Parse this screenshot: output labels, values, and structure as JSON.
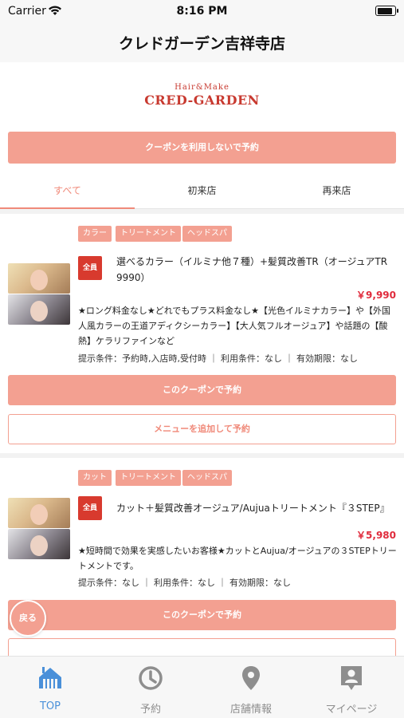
{
  "status_bar": {
    "carrier": "Carrier",
    "time": "8:16 PM"
  },
  "nav": {
    "title": "クレドガーデン吉祥寺店"
  },
  "logo": {
    "top": "Hair&Make",
    "main": "CRED-GARDEN"
  },
  "reserve_without_coupon": "クーポンを利用しないで予約",
  "tabs": [
    {
      "label": "すべて",
      "active": true
    },
    {
      "label": "初来店",
      "active": false
    },
    {
      "label": "再来店",
      "active": false
    }
  ],
  "coupons": [
    {
      "tags": [
        "カラー",
        "トリートメント",
        "ヘッドスパ"
      ],
      "badge": "全員",
      "name": "選べるカラー（イルミナ他７種）+髪質改善TR（オージュアTR 9990）",
      "price": "￥9,990",
      "description": "★ロング料金なし★どれでもプラス料金なし★【光色イルミナカラー】や【外国人風カラーの王道アディクシーカラー】【大人気フルオージュア】や話題の【酸熱】ケラリファインなど",
      "conditions": "提示条件：予約時,入店時,受付時 ｜ 利用条件：なし ｜ 有効期限：なし",
      "reserve_label": "このクーポンで予約",
      "add_menu_label": "メニューを追加して予約"
    },
    {
      "tags": [
        "カット",
        "トリートメント",
        "ヘッドスパ"
      ],
      "badge": "全員",
      "name": "カット＋髪質改善オージュア/Aujuaトリートメント『３STEP』",
      "price": "￥5,980",
      "description": "★短時間で効果を実感したいお客様★カットとAujua/オージュアの３STEPトリートメントです。",
      "conditions": "提示条件：なし ｜ 利用条件：なし ｜ 有効期限：なし",
      "reserve_label": "このクーポンで予約"
    }
  ],
  "back_button": "戻る",
  "tab_bar": [
    {
      "label": "TOP",
      "icon": "home-icon",
      "active": true
    },
    {
      "label": "予約",
      "icon": "clock-icon",
      "active": false
    },
    {
      "label": "店舗情報",
      "icon": "map-pin-icon",
      "active": false
    },
    {
      "label": "マイページ",
      "icon": "person-card-icon",
      "active": false
    }
  ],
  "colors": {
    "accent": "#f3a091",
    "badge": "#d83a2e",
    "price": "#e02b3c",
    "tab_active": "#4a90d9"
  }
}
